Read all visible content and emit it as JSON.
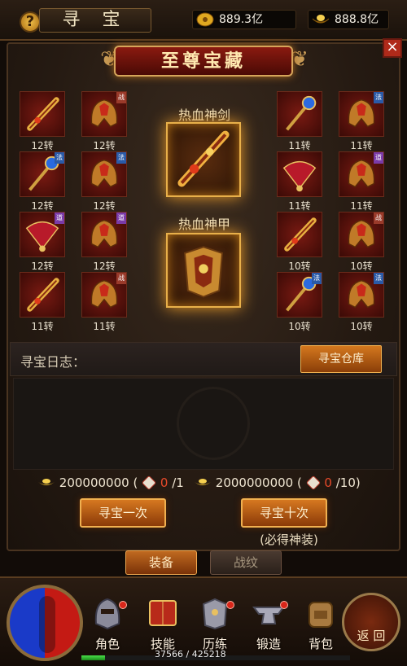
{
  "header": {
    "help_icon": "question-icon",
    "help_label": "?",
    "title": "寻 宝",
    "currencies": [
      {
        "icon": "gold-ingot-icon",
        "value": "889.3亿"
      },
      {
        "icon": "yuanbao-icon",
        "value": "888.8亿"
      }
    ]
  },
  "close_label": "×",
  "banner": {
    "title": "至尊宝藏"
  },
  "features": [
    {
      "title": "热血神剑",
      "item": "sword-icon"
    },
    {
      "title": "热血神甲",
      "item": "armor-icon"
    }
  ],
  "left_items": [
    {
      "label": "12转",
      "icon": "sword-icon",
      "tag": ""
    },
    {
      "label": "12转",
      "icon": "helmet-icon",
      "tag": "战"
    },
    {
      "label": "12转",
      "icon": "staff-icon",
      "tag": "法"
    },
    {
      "label": "12转",
      "icon": "helmet-icon",
      "tag": "法"
    },
    {
      "label": "12转",
      "icon": "fan-icon",
      "tag": "道"
    },
    {
      "label": "12转",
      "icon": "helmet-icon",
      "tag": "道"
    },
    {
      "label": "11转",
      "icon": "sword-icon",
      "tag": ""
    },
    {
      "label": "11转",
      "icon": "helmet-icon",
      "tag": "战"
    }
  ],
  "right_items": [
    {
      "label": "11转",
      "icon": "staff-icon",
      "tag": ""
    },
    {
      "label": "11转",
      "icon": "helmet-icon",
      "tag": "法"
    },
    {
      "label": "11转",
      "icon": "fan-icon",
      "tag": ""
    },
    {
      "label": "11转",
      "icon": "helmet-icon",
      "tag": "道"
    },
    {
      "label": "10转",
      "icon": "sword-icon",
      "tag": ""
    },
    {
      "label": "10转",
      "icon": "helmet-icon",
      "tag": "战"
    },
    {
      "label": "10转",
      "icon": "staff-icon",
      "tag": "法"
    },
    {
      "label": "10转",
      "icon": "helmet-icon",
      "tag": "法"
    }
  ],
  "log": {
    "label": "寻宝日志：",
    "warehouse_button": "寻宝仓库"
  },
  "draw_once": {
    "cost": "200000000",
    "paren_open": "(",
    "scroll_count": "0",
    "scroll_total": "/1",
    "button": "寻宝一次"
  },
  "draw_ten": {
    "cost": "2000000000",
    "paren_open": "(",
    "scroll_count": "0",
    "scroll_total": "/10)",
    "button": "寻宝十次",
    "note": "(必得神装)"
  },
  "tabs": [
    {
      "label": "装备",
      "active": true
    },
    {
      "label": "战纹",
      "active": false
    }
  ],
  "nav": [
    {
      "label": "角色",
      "icon": "helmet-icon",
      "dot": true
    },
    {
      "label": "技能",
      "icon": "skill-book-icon",
      "dot": false
    },
    {
      "label": "历练",
      "icon": "armor-icon",
      "dot": true
    },
    {
      "label": "锻造",
      "icon": "anvil-icon",
      "dot": true
    },
    {
      "label": "背包",
      "icon": "backpack-icon",
      "dot": false
    }
  ],
  "return_label": "返 回",
  "exp": {
    "text": "37566 / 425218",
    "fraction": 0.088
  }
}
